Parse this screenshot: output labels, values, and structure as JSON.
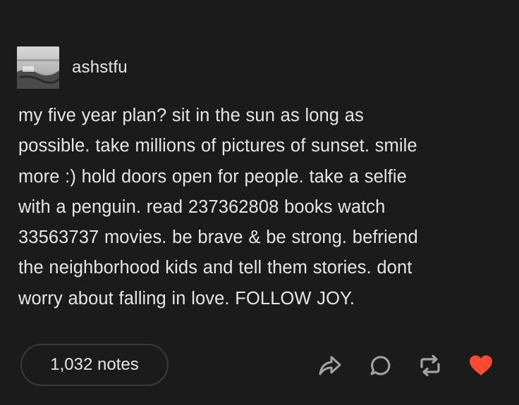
{
  "post": {
    "username": "ashstfu",
    "body_lines": [
      "my five year plan? sit in the sun as long as",
      "possible. take millions of pictures of sunset. smile",
      "more :) hold doors open for people. take a selfie",
      "with a penguin. read 237362808 books watch",
      "33563737 movies. be brave & be strong. befriend",
      "the neighborhood kids and tell them stories. dont",
      "worry about falling in love. FOLLOW JOY."
    ],
    "notes_label": "1,032 notes"
  },
  "icons": {
    "share": "share-arrow-icon",
    "reply": "reply-bubble-icon",
    "reblog": "reblog-icon",
    "like": "heart-icon"
  },
  "colors": {
    "background": "#1b1b1b",
    "text": "#e6e6e6",
    "like_active": "#ff4930",
    "icon_gray": "#9a9a9a"
  }
}
